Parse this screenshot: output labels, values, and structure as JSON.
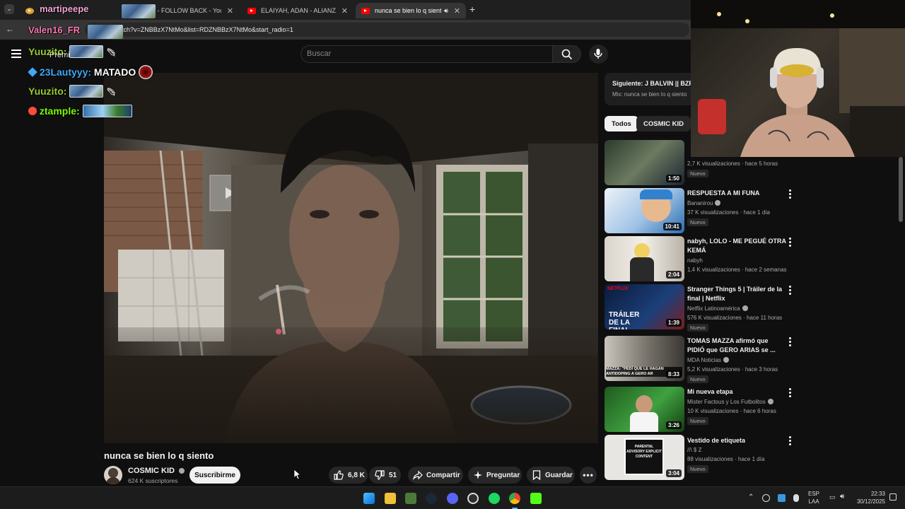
{
  "browser": {
    "tabs": [
      {
        "label": "",
        "active": false
      },
      {
        "label": "ZERO - FOLLOW BACK - You",
        "active": false
      },
      {
        "label": "ELAIYAH, ADAN - ALIANZA (pr",
        "active": false
      },
      {
        "label": "nunca se bien lo q siento -",
        "active": true
      }
    ],
    "url": "tch?v=ZNBBzX7NtMo&list=RDZNBBzX7NtMo&start_radio=1"
  },
  "youtube": {
    "search_placeholder": "Buscar",
    "video": {
      "title": "nunca se bien lo q siento",
      "channel": "COSMIC KID",
      "subscribers": "624 K suscriptores",
      "subscribe_label": "Suscribirme",
      "likes": "6,8 K",
      "dislikes": "51",
      "share_label": "Compartir",
      "ask_label": "Preguntar",
      "save_label": "Guardar"
    },
    "up_next": {
      "title": "Siguiente: J BALVIN || BZR",
      "subtitle": "Mix: nunca se bien lo q siento"
    },
    "chips": [
      "Todos",
      "COSMIC KID"
    ],
    "recommendations": [
      {
        "title": "",
        "channel": "",
        "meta": "2,7 K visualizaciones · hace 5 horas",
        "badge": "Nuevo",
        "duration": "1:50"
      },
      {
        "title": "RESPUESTA A MI FUNA",
        "channel": "Bananirou",
        "meta": "37 K visualizaciones · hace 1 día",
        "badge": "Nuevo",
        "duration": "10:41"
      },
      {
        "title": "nabyh, LOLO - ME PEGUÉ OTRA KEMÁ",
        "channel": "nabyh",
        "meta": "1,4 K visualizaciones · hace 2 semanas",
        "badge": "",
        "duration": "2:04"
      },
      {
        "title": "Stranger Things 5 | Tráiler de la final | Netflix",
        "channel": "Netflix Latinoamérica",
        "meta": "576 K visualizaciones · hace 11 horas",
        "badge": "Nuevo",
        "duration": "1:39"
      },
      {
        "title": "TOMAS MAZZA afirmó que PIDIÓ que GERO ARIAS se ...",
        "channel": "MDA Noticias",
        "meta": "5,2 K visualizaciones · hace 3 horas",
        "badge": "Nuevo",
        "duration": "8:33"
      },
      {
        "title": "Mi nueva etapa",
        "channel": "Mister Factous y Los Futbolitos",
        "meta": "10 K visualizaciones · hace 6 horas",
        "badge": "Nuevo",
        "duration": "3:26"
      },
      {
        "title": "Vestido de etiqueta",
        "channel": "//\\ $ Z",
        "meta": "88 visualizaciones · hace 1 día",
        "badge": "Nuevo",
        "duration": "3:04"
      }
    ],
    "thumb_texts": {
      "netflix": "NETFLIX",
      "trailer": "TRÁILER DE LA FINAL",
      "mazza": "MAZZA: \"PEDÍ QUE LE HAGAN ANTIDOPING A GERO AR",
      "advisory": "PARENTAL ADVISORY EXPLICIT CONTENT"
    }
  },
  "chat": [
    {
      "user": "Yuuzito:",
      "text": "",
      "color": "#9acd32"
    },
    {
      "user": "23Lautyyy:",
      "text": " MATADO",
      "color": "#3fa9f5"
    },
    {
      "user": "Yuuzito:",
      "text": "",
      "color": "#9acd32"
    },
    {
      "user": "ztample:",
      "text": "",
      "color": "#7cfc00"
    }
  ],
  "overlay": {
    "name_top": "martipeepe",
    "name2": "Valen16_FR",
    "premium_fragment": "Premi"
  },
  "taskbar": {
    "lang": [
      "ESP",
      "LAA"
    ],
    "time": "22:33",
    "date": "30/12/2025"
  },
  "colors": {
    "accent": "#ff0000",
    "bg": "#0f0f0f",
    "chip_active": "#f1f1f1"
  }
}
